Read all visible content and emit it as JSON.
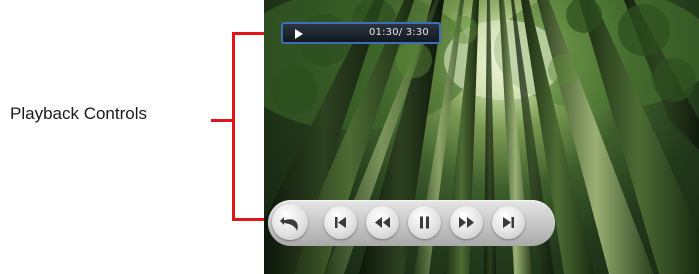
{
  "callout": {
    "label": "Playback Controls",
    "line_color": "#e2141c"
  },
  "player": {
    "status_bar": {
      "icon": "play-icon",
      "time": "01:30/ 3:30"
    },
    "controls": [
      {
        "name": "back-button",
        "icon": "undo-arrow-icon"
      },
      {
        "name": "previous-track-button",
        "icon": "skip-previous-icon"
      },
      {
        "name": "rewind-button",
        "icon": "rewind-icon"
      },
      {
        "name": "pause-button",
        "icon": "pause-icon"
      },
      {
        "name": "fast-forward-button",
        "icon": "fast-forward-icon"
      },
      {
        "name": "next-track-button",
        "icon": "skip-next-icon"
      }
    ]
  },
  "colors": {
    "status_border": "#3d6fb6",
    "icon_color": "#3a3a3a"
  }
}
